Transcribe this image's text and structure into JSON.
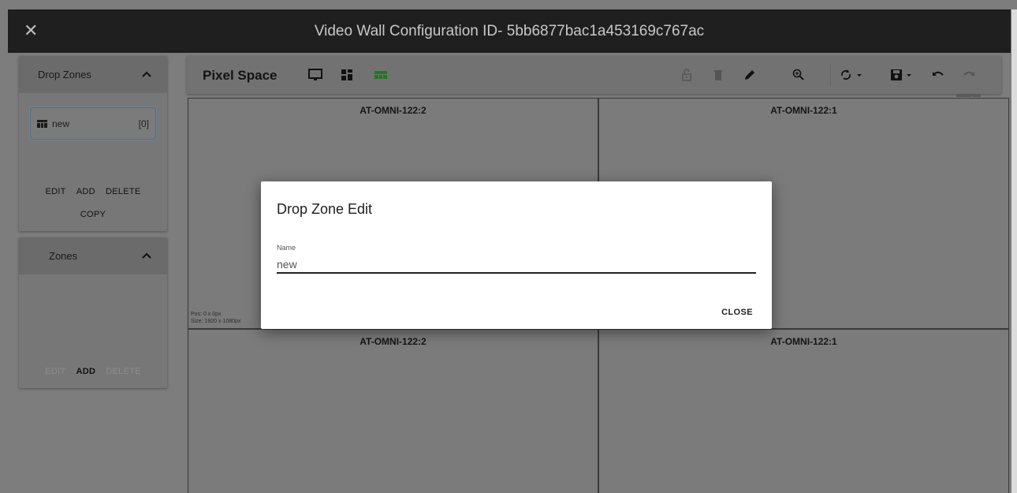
{
  "window": {
    "title": "Video Wall Configuration ID- 5bb6877bac1a453169c767ac",
    "close_icon": "close-icon"
  },
  "drop_zones_panel": {
    "header": "Drop Zones",
    "items": [
      {
        "icon": "layout-icon",
        "name": "new",
        "count": "[0]"
      }
    ],
    "actions": {
      "edit": "EDIT",
      "add": "ADD",
      "delete": "DELETE",
      "copy": "COPY"
    }
  },
  "zones_panel": {
    "header": "Zones",
    "actions": {
      "edit": "EDIT",
      "add": "ADD",
      "delete": "DELETE"
    }
  },
  "toolbar": {
    "title": "Pixel Space",
    "icons": [
      "monitor-icon",
      "dashboard-icon",
      "layout-icon",
      "lock-open-icon",
      "delete-icon",
      "edit-icon",
      "zoom-icon",
      "sync-icon",
      "save-icon",
      "undo-icon",
      "redo-icon"
    ],
    "active_color": "#1f7a1f",
    "redo_tooltip": "Redo"
  },
  "canvas": {
    "tiles": [
      {
        "name": "AT-OMNI-122:2",
        "pos": "Pos: 0 x 0px",
        "size": "Size: 1920 x 1080px"
      },
      {
        "name": "AT-OMNI-122:1"
      },
      {
        "name": "AT-OMNI-122:2"
      },
      {
        "name": "AT-OMNI-122:1"
      }
    ]
  },
  "dialog": {
    "title": "Drop Zone Edit",
    "field_label": "Name",
    "field_value": "new",
    "close_label": "CLOSE"
  }
}
